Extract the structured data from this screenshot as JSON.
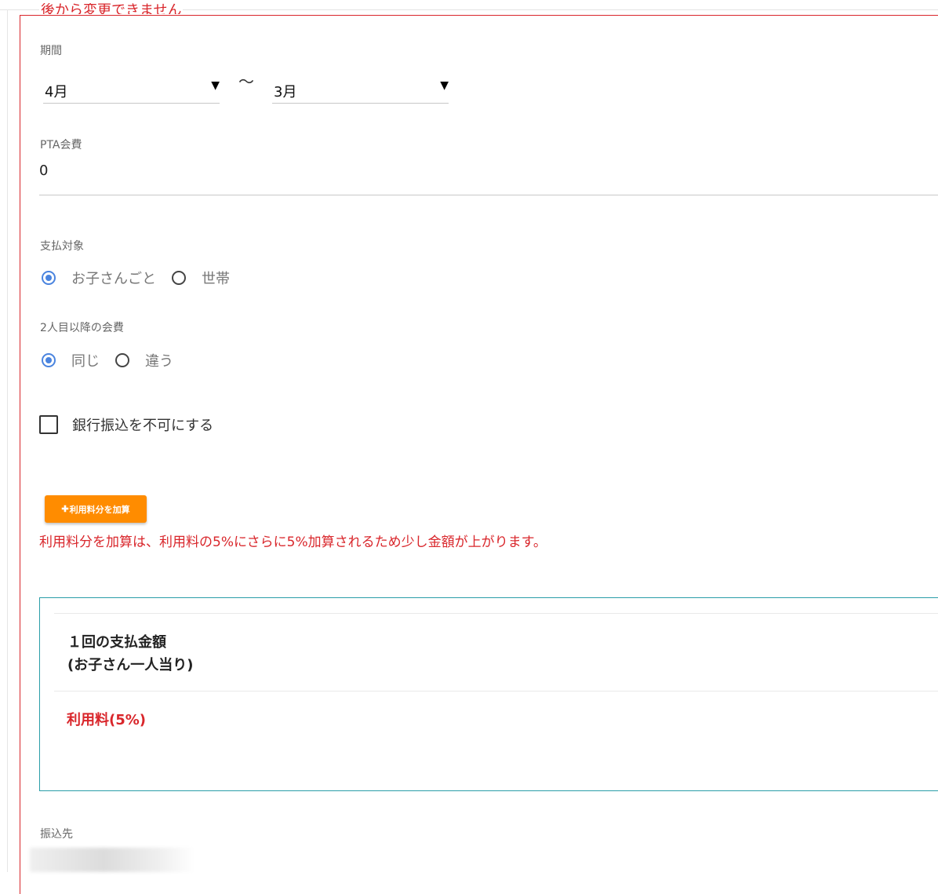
{
  "form": {
    "legend": "後から変更できません",
    "period": {
      "label": "期間",
      "start": "4月",
      "separator": "〜",
      "end": "3月"
    },
    "fee": {
      "label": "PTA会費",
      "value": "0"
    },
    "payment_target": {
      "label": "支払対象",
      "options": [
        "お子さんごと",
        "世帯"
      ],
      "selected": "お子さんごと"
    },
    "second_child_fee": {
      "label": "2人目以降の会費",
      "options": [
        "同じ",
        "違う"
      ],
      "selected": "同じ"
    },
    "bank_transfer": {
      "label": "銀行振込を不可にする",
      "checked": false
    },
    "add_fee_button": {
      "icon": "plus-icon",
      "label": "利用料分を加算",
      "color": "#ff8c00"
    },
    "note": "利用料分を加算は、利用料の5%にさらに5%加算されるため少し金額が上がります。",
    "summary": {
      "title_line1": "１回の支払金額",
      "title_line2": "(お子さん一人当り)",
      "fee_label": "利用料(5%)"
    },
    "transfer_to": {
      "label": "振込先"
    }
  },
  "colors": {
    "accent_red": "#d9262b",
    "radio_blue": "#4a84df",
    "box_teal": "#2a9ea8"
  }
}
